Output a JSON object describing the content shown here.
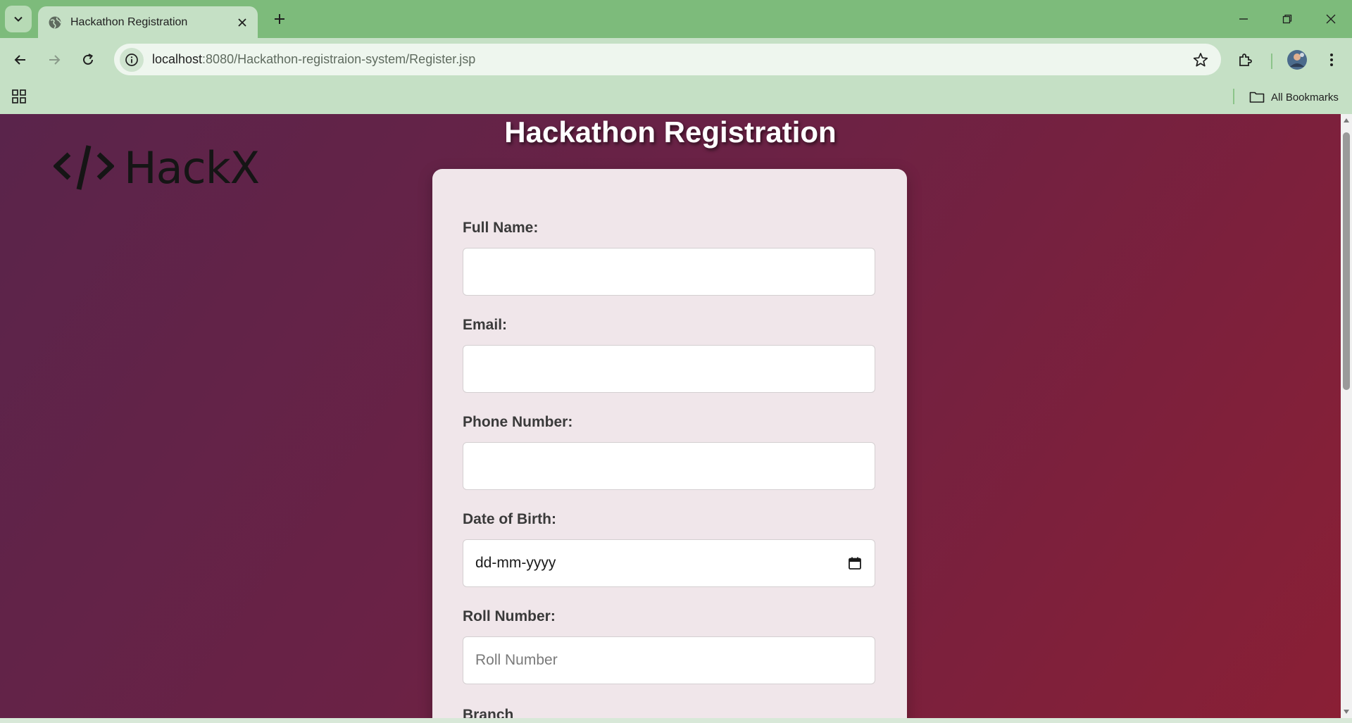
{
  "browser": {
    "tab_title": "Hackathon Registration",
    "url_host": "localhost",
    "url_rest": ":8080/Hackathon-registraion-system/Register.jsp",
    "all_bookmarks": "All Bookmarks"
  },
  "page": {
    "logo_text": "HackX",
    "title": "Hackathon Registration"
  },
  "form": {
    "full_name": {
      "label": "Full Name:",
      "value": ""
    },
    "email": {
      "label": "Email:",
      "value": ""
    },
    "phone": {
      "label": "Phone Number:",
      "value": ""
    },
    "dob": {
      "label": "Date of Birth:",
      "placeholder": "dd-mm-yyyy"
    },
    "roll": {
      "label": "Roll Number:",
      "placeholder": "Roll Number"
    },
    "branch": {
      "label": "Branch"
    }
  },
  "icons": {
    "tab_search": "chevron-down-icon",
    "favicon": "globe-icon",
    "tab_close": "close-icon",
    "new_tab": "plus-icon",
    "back": "arrow-left-icon",
    "forward": "arrow-right-icon",
    "reload": "reload-icon",
    "site_info": "info-icon",
    "bookmark_star": "star-icon",
    "extensions": "puzzle-icon",
    "profile": "avatar",
    "menu": "kebab-menu-icon",
    "apps": "apps-grid-icon",
    "folder": "folder-icon",
    "calendar": "calendar-icon",
    "logo": "code-brackets-icon"
  },
  "colors": {
    "tabbar": "#7dbb7b",
    "toolbar": "#c5e0c5",
    "gradient_start": "#5a244b",
    "gradient_end": "#8a1f35",
    "card": "#f0e6ea"
  }
}
